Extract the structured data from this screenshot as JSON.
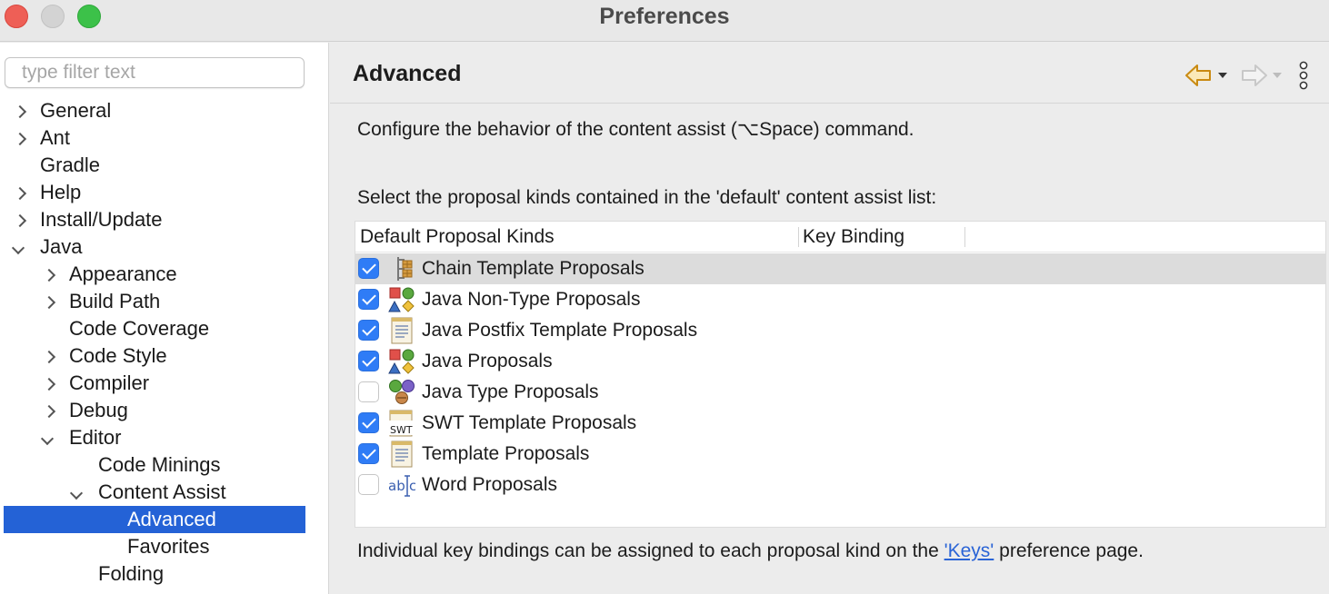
{
  "window": {
    "title": "Preferences"
  },
  "sidebar": {
    "filter_placeholder": "type filter text",
    "items": [
      {
        "label": "General",
        "expander": "collapsed"
      },
      {
        "label": "Ant",
        "expander": "collapsed"
      },
      {
        "label": "Gradle",
        "expander": "none"
      },
      {
        "label": "Help",
        "expander": "collapsed"
      },
      {
        "label": "Install/Update",
        "expander": "collapsed"
      },
      {
        "label": "Java",
        "expander": "expanded"
      },
      {
        "label": "Appearance",
        "expander": "collapsed"
      },
      {
        "label": "Build Path",
        "expander": "collapsed"
      },
      {
        "label": "Code Coverage",
        "expander": "none"
      },
      {
        "label": "Code Style",
        "expander": "collapsed"
      },
      {
        "label": "Compiler",
        "expander": "collapsed"
      },
      {
        "label": "Debug",
        "expander": "collapsed"
      },
      {
        "label": "Editor",
        "expander": "expanded"
      },
      {
        "label": "Code Minings",
        "expander": "none"
      },
      {
        "label": "Content Assist",
        "expander": "expanded"
      },
      {
        "label": "Advanced",
        "expander": "none",
        "selected": true
      },
      {
        "label": "Favorites",
        "expander": "none"
      },
      {
        "label": "Folding",
        "expander": "none"
      }
    ]
  },
  "page": {
    "title": "Advanced",
    "description": "Configure the behavior of the content assist (⌥Space) command.",
    "select_label": "Select the proposal kinds contained in the 'default' content assist list:",
    "table": {
      "columns": [
        "Default Proposal Kinds",
        "Key Binding"
      ],
      "rows": [
        {
          "label": "Chain Template Proposals",
          "checked": true,
          "icon": "chain-template-icon",
          "highlighted": true
        },
        {
          "label": "Java Non-Type Proposals",
          "checked": true,
          "icon": "java-non-type-icon"
        },
        {
          "label": "Java Postfix Template Proposals",
          "checked": true,
          "icon": "template-icon"
        },
        {
          "label": "Java Proposals",
          "checked": true,
          "icon": "java-non-type-icon"
        },
        {
          "label": "Java Type Proposals",
          "checked": false,
          "icon": "java-type-icon"
        },
        {
          "label": "SWT Template Proposals",
          "checked": true,
          "icon": "swt-template-icon"
        },
        {
          "label": "Template Proposals",
          "checked": true,
          "icon": "template-icon"
        },
        {
          "label": "Word Proposals",
          "checked": false,
          "icon": "word-icon"
        }
      ]
    },
    "footer_prefix": "Individual key bindings can be assigned to each proposal kind on the ",
    "footer_link": "'Keys'",
    "footer_suffix": " preference page."
  },
  "colors": {
    "selection": "#2462d6",
    "checkbox": "#2f7cf6",
    "link": "#2a64d6",
    "back_arrow": "#e0a21c"
  }
}
